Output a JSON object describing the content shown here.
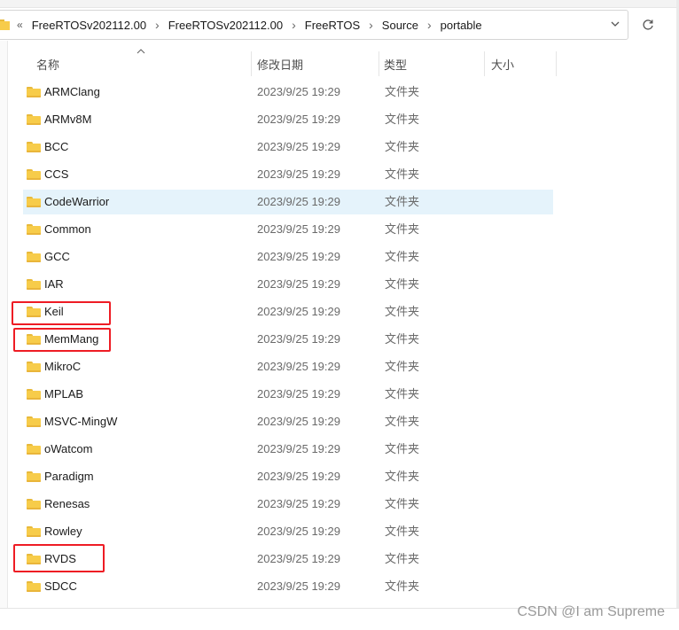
{
  "breadcrumb": {
    "overflow": "«",
    "items": [
      "FreeRTOSv202112.00",
      "FreeRTOSv202112.00",
      "FreeRTOS",
      "Source",
      "portable"
    ],
    "separator": "›"
  },
  "address_bar": {
    "dropdown_icon": "chevron-down-icon",
    "refresh_icon": "refresh-icon"
  },
  "columns": {
    "name": "名称",
    "date": "修改日期",
    "type": "类型",
    "size": "大小",
    "sorted_by": "name",
    "sort_direction": "ascending"
  },
  "files": [
    {
      "name": "ARMClang",
      "date": "2023/9/25 19:29",
      "type": "文件夹"
    },
    {
      "name": "ARMv8M",
      "date": "2023/9/25 19:29",
      "type": "文件夹"
    },
    {
      "name": "BCC",
      "date": "2023/9/25 19:29",
      "type": "文件夹"
    },
    {
      "name": "CCS",
      "date": "2023/9/25 19:29",
      "type": "文件夹"
    },
    {
      "name": "CodeWarrior",
      "date": "2023/9/25 19:29",
      "type": "文件夹"
    },
    {
      "name": "Common",
      "date": "2023/9/25 19:29",
      "type": "文件夹"
    },
    {
      "name": "GCC",
      "date": "2023/9/25 19:29",
      "type": "文件夹"
    },
    {
      "name": "IAR",
      "date": "2023/9/25 19:29",
      "type": "文件夹"
    },
    {
      "name": "Keil",
      "date": "2023/9/25 19:29",
      "type": "文件夹"
    },
    {
      "name": "MemMang",
      "date": "2023/9/25 19:29",
      "type": "文件夹"
    },
    {
      "name": "MikroC",
      "date": "2023/9/25 19:29",
      "type": "文件夹"
    },
    {
      "name": "MPLAB",
      "date": "2023/9/25 19:29",
      "type": "文件夹"
    },
    {
      "name": "MSVC-MingW",
      "date": "2023/9/25 19:29",
      "type": "文件夹"
    },
    {
      "name": "oWatcom",
      "date": "2023/9/25 19:29",
      "type": "文件夹"
    },
    {
      "name": "Paradigm",
      "date": "2023/9/25 19:29",
      "type": "文件夹"
    },
    {
      "name": "Renesas",
      "date": "2023/9/25 19:29",
      "type": "文件夹"
    },
    {
      "name": "Rowley",
      "date": "2023/9/25 19:29",
      "type": "文件夹"
    },
    {
      "name": "RVDS",
      "date": "2023/9/25 19:29",
      "type": "文件夹"
    },
    {
      "name": "SDCC",
      "date": "2023/9/25 19:29",
      "type": "文件夹"
    }
  ],
  "hovered_row": "CodeWarrior",
  "highlighted_rows": [
    "Keil",
    "MemMang",
    "RVDS"
  ],
  "colors": {
    "highlight_box": "#ee1c24",
    "hover_row": "#e5f3fb",
    "folder": "#f7cc4a"
  },
  "watermark": "CSDN @I am Supreme"
}
